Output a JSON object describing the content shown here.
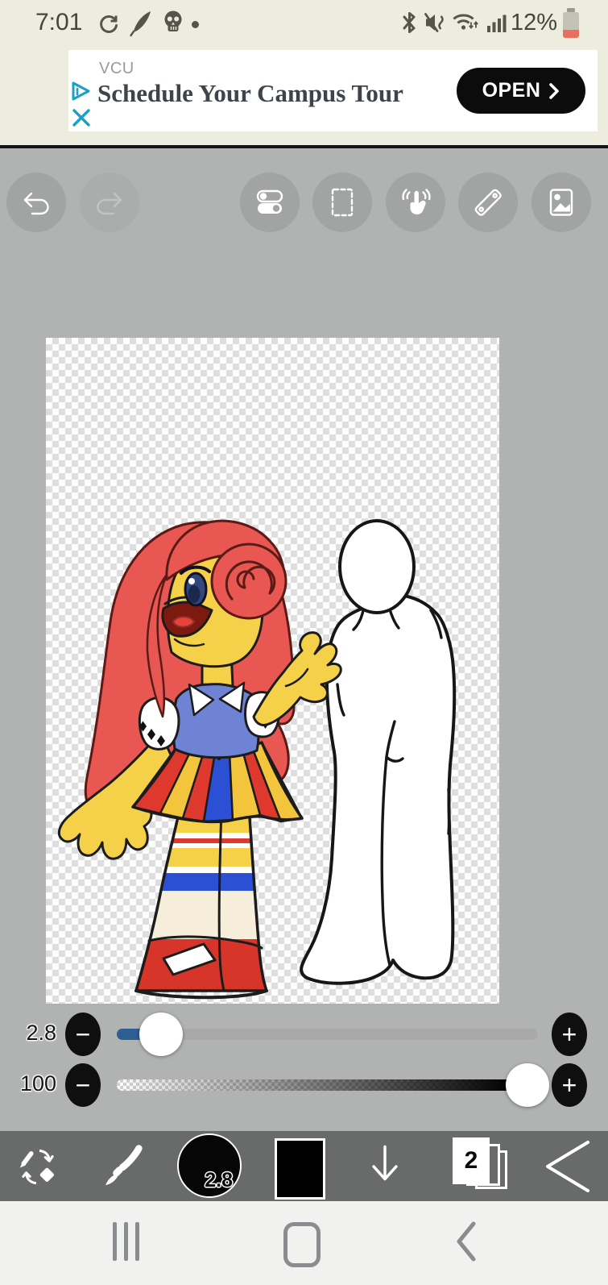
{
  "status_bar": {
    "time": "7:01",
    "battery_percent": "12%",
    "notification_icons": [
      "sync-icon",
      "feather-icon",
      "skull-icon",
      "notification-dot"
    ],
    "system_icons": [
      "bluetooth-icon",
      "mute-vibrate-icon",
      "wifi-icon",
      "signal-icon",
      "battery-icon"
    ]
  },
  "ad_banner": {
    "advertiser": "VCU",
    "headline": "Schedule Your Campus Tour",
    "cta_label": "OPEN",
    "adchoices_icon": "adchoices-icon",
    "close_icon": "close-x-icon"
  },
  "top_toolbar": {
    "buttons": [
      "undo",
      "redo",
      "tool-property",
      "selection",
      "transform-hand",
      "ruler",
      "material"
    ],
    "undo_enabled": true,
    "redo_enabled": false
  },
  "canvas": {
    "background": "transparent-checkerboard",
    "artwork_colors": {
      "hair": "#e85752",
      "skin": "#f5d049",
      "vest": "#6f83d4",
      "skirt_red": "#df382c",
      "skirt_yellow": "#f3c53d",
      "skirt_blue": "#2b50d4",
      "shoe": "#d8352a",
      "sketch_outline": "#161616"
    }
  },
  "sliders": {
    "brush_size": {
      "value": "2.8",
      "minus_label": "−",
      "plus_label": "+",
      "fill_color": "#2e5f93"
    },
    "opacity": {
      "value": "100",
      "minus_label": "−",
      "plus_label": "+"
    }
  },
  "bottom_toolbar": {
    "icons": [
      "pen-eraser-swap-icon",
      "brush-icon",
      "brush-size-preview",
      "color-swatch",
      "down-arrow-icon",
      "layers-icon",
      "back-arrow-icon"
    ],
    "brush_size_badge": "2.8",
    "layers_count": "2"
  },
  "nav_bar": {
    "icons": [
      "recents-icon",
      "home-icon",
      "back-icon"
    ]
  },
  "colors": {
    "app_background": "#b1b3b2",
    "toolbar_dark": "#696b6a",
    "status_bar_bg": "#ededdf",
    "accent_blue": "#2e5f93",
    "ad_cta_bg": "#0c0c0c",
    "teal": "#1ba0c4"
  }
}
